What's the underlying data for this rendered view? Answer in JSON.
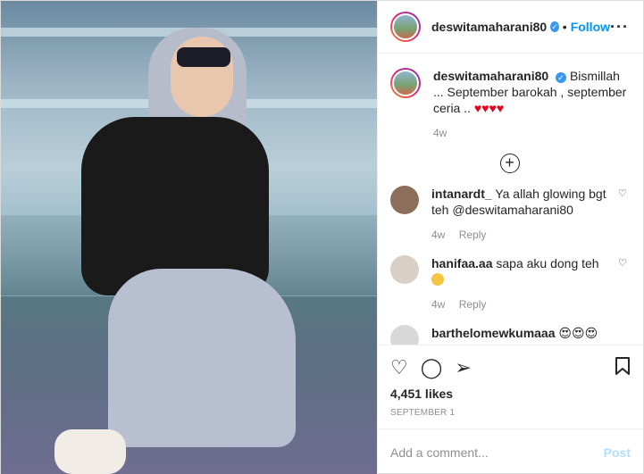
{
  "post": {
    "username": "deswitamaharani80",
    "verified_glyph": "✓",
    "separator": "•",
    "follow_label": "Follow",
    "more_glyph": "···"
  },
  "caption": {
    "username": "deswitamaharani80",
    "text": "Bismillah ... September barokah , september ceria ..",
    "hearts": "♥♥♥♥",
    "time": "4w"
  },
  "load_more_glyph": "+",
  "comments": [
    {
      "username": "intanardt_",
      "text": "Ya allah glowing bgt teh @deswitamaharani80",
      "time": "4w",
      "reply": "Reply",
      "avatar_color": "#8b6f5a"
    },
    {
      "username": "hanifaa.aa",
      "text": "sapa aku dong teh",
      "time": "4w",
      "reply": "Reply",
      "avatar_color": "#d9cfc4"
    },
    {
      "username": "barthelomewkumaaa",
      "text": "",
      "time": "",
      "reply": "",
      "avatar_color": "#d8d8d8"
    }
  ],
  "actions": {
    "like_glyph": "♡",
    "comment_glyph": "◯",
    "share_glyph": "➢",
    "save_glyph": "⊓"
  },
  "likes": "4,451 likes",
  "date": "SEPTEMBER 1",
  "add_comment": {
    "placeholder": "Add a comment...",
    "post_label": "Post"
  },
  "colors": {
    "accent": "#0095f6",
    "heart": "#e3001b"
  }
}
